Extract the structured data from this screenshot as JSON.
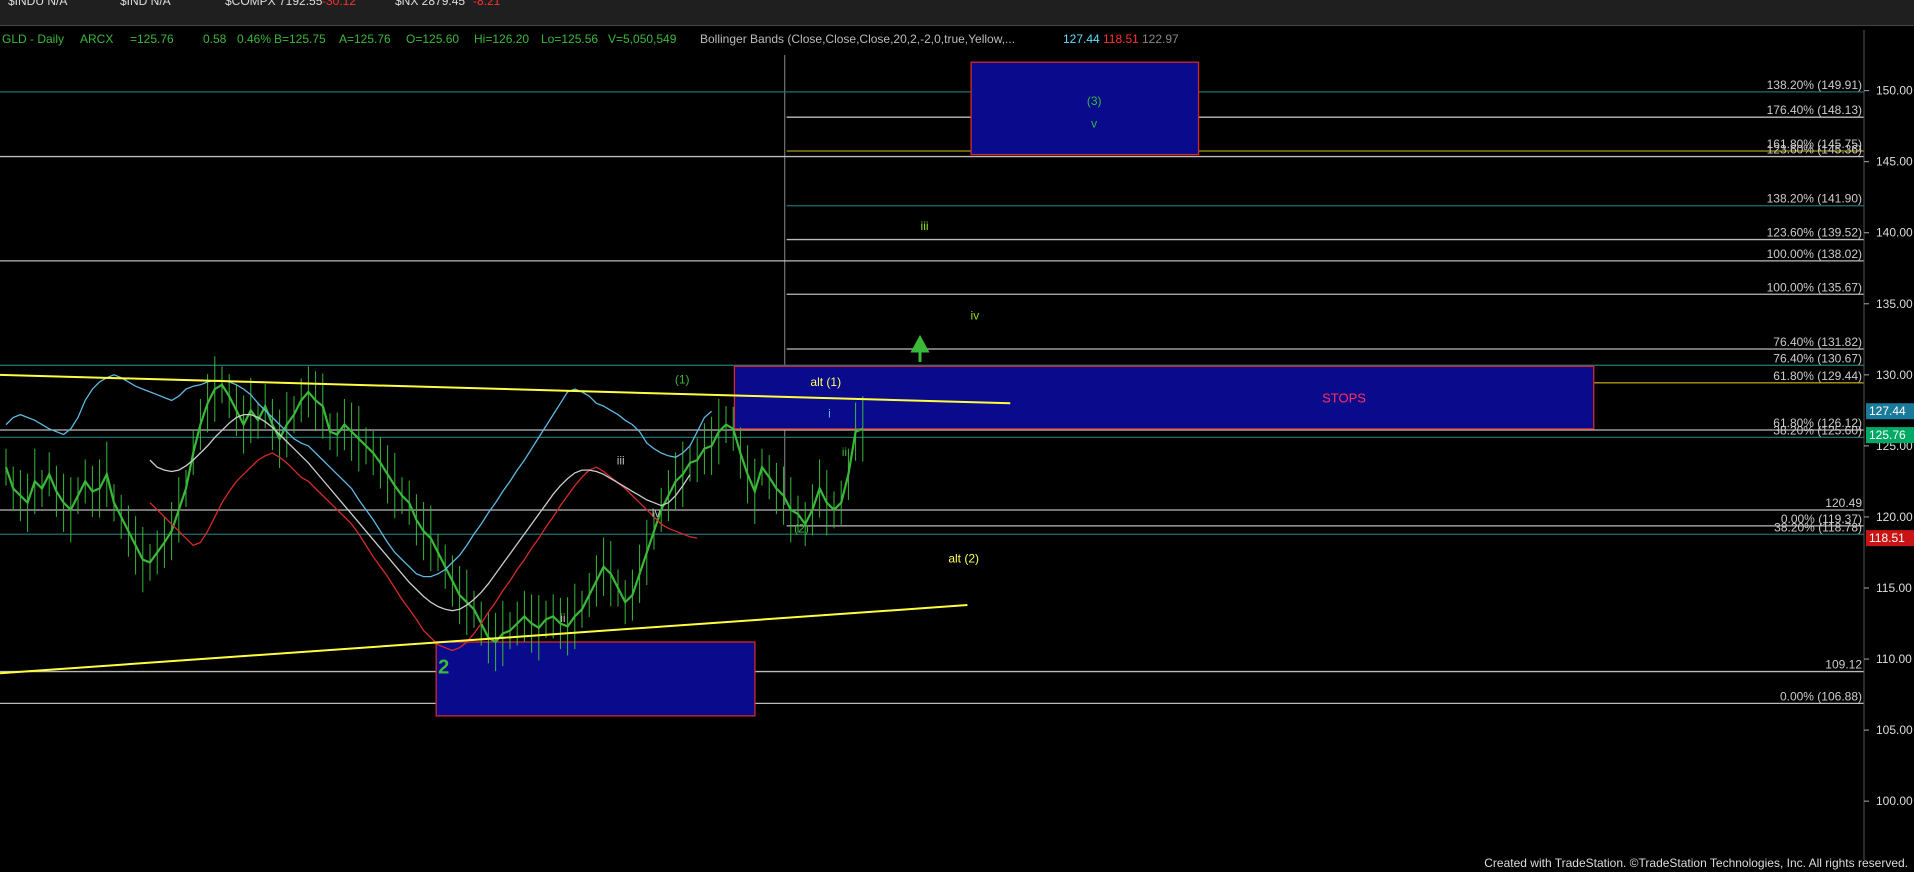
{
  "window": {
    "tickers": [
      {
        "symbol": "$INDU N/A",
        "change": ""
      },
      {
        "symbol": "$IND N/A",
        "change": ""
      },
      {
        "symbol": "$COMPX 7192.55",
        "change": "-30.12"
      },
      {
        "symbol": "$NX 2879.45",
        "change": "-8.21"
      }
    ]
  },
  "header": {
    "symbol": "GLD - Daily",
    "exchange": "ARCX",
    "last": "=125.76",
    "change": "0.58",
    "pct": "0.46%",
    "bid": "B=125.75",
    "ask": "A=125.76",
    "open": "O=125.60",
    "high": "Hi=126.20",
    "low": "Lo=125.56",
    "volume": "V=5,050,549",
    "study": "Bollinger Bands (Close,Close,Close,20,2,-2,0,true,Yellow,...",
    "bb_upper": "127.44",
    "bb_lower": "118.51",
    "bb_mid": "122.97"
  },
  "footer": "Created with TradeStation. ©TradeStation Technologies, Inc. All rights reserved.",
  "colors": {
    "price": "#3ab83a",
    "bb_upper": "#5fb8e0",
    "bb_lower": "#d42a2a",
    "bb_mid": "#cccccc",
    "trendline": "#ffff40",
    "box_fill": "#0a0a8c",
    "box_border": "#d42a2a",
    "level_label": "#cccccc",
    "last_price_tag": "#00aa66",
    "bb_upper_tag": "#1a7a9a",
    "bb_lower_tag": "#c81414"
  },
  "chart_data": {
    "type": "line",
    "title": "GLD - Daily",
    "ylim": [
      96,
      153
    ],
    "y_ticks": [
      100,
      105,
      110,
      115,
      120,
      125,
      130,
      135,
      140,
      145,
      150
    ],
    "bars": 120,
    "series": [
      {
        "name": "GLD",
        "values": [
          123.5,
          122,
          121.5,
          121,
          122.5,
          122,
          123,
          121.8,
          121,
          120.5,
          121.5,
          122.5,
          121.8,
          122,
          123,
          121,
          120,
          119,
          118,
          117,
          116.8,
          117.5,
          118.2,
          119,
          120.5,
          122,
          124.5,
          126.5,
          128,
          129,
          129.3,
          128.5,
          127.5,
          126.5,
          127.5,
          126.8,
          127.8,
          126.5,
          125.5,
          126.5,
          127.2,
          128.2,
          128.8,
          128.2,
          127.8,
          126,
          125.8,
          126.5,
          126,
          125.5,
          125,
          124.5,
          123.8,
          123,
          122.2,
          121.5,
          121,
          119.8,
          119,
          118.5,
          117.5,
          116.5,
          115.5,
          114.5,
          114,
          113.5,
          112.5,
          111.5,
          111.2,
          111.8,
          112,
          112.5,
          113,
          112.5,
          112.2,
          112.8,
          113,
          112.5,
          112.3,
          113,
          113.5,
          114.5,
          115.5,
          116.5,
          116,
          115,
          114,
          114.5,
          116,
          117.5,
          119,
          120.5,
          121.5,
          122.5,
          123,
          123.8,
          124,
          124.8,
          125,
          126,
          126.5,
          126.2,
          124.5,
          123,
          121.8,
          123.5,
          122.8,
          122,
          121.5,
          120.5,
          120.2,
          119.5,
          120.5,
          122,
          121,
          120.5,
          121,
          123,
          126,
          126.2
        ]
      },
      {
        "name": "BB Upper",
        "values": [
          126.5,
          127,
          127.2,
          127,
          126.8,
          126.5,
          126.2,
          126,
          125.8,
          126.2,
          127,
          128.2,
          129,
          129.5,
          129.8,
          130,
          129.8,
          129.5,
          129.2,
          129,
          128.8,
          128.6,
          128.4,
          128.2,
          128.5,
          129,
          129.2,
          129.3,
          129.5,
          129.6,
          129.6,
          129.5,
          129.3,
          129,
          128.6,
          128,
          127.5,
          127,
          126.5,
          126,
          125.5,
          125.2,
          125,
          124.5,
          124,
          123.5,
          123,
          122.5,
          122,
          121.2,
          120.5,
          119.8,
          119,
          118.2,
          117.5,
          117,
          116.5,
          116,
          115.8,
          115.8,
          116,
          116.3,
          116.8,
          117.3,
          118,
          118.8,
          119.5,
          120.3,
          121,
          121.8,
          122.5,
          123.3,
          124,
          124.8,
          125.6,
          126.4,
          127.2,
          128,
          128.8,
          129,
          128.8,
          128.5,
          128,
          127.8,
          127.5,
          127.2,
          126.8,
          126.5,
          126,
          125.2,
          124.8,
          124.5,
          124.3,
          124.2,
          124.5,
          125,
          126,
          127,
          127.44
        ]
      },
      {
        "name": "BB Lower",
        "values": [
          121,
          120.5,
          120,
          119.5,
          119,
          118.5,
          118,
          118.2,
          119,
          120,
          121,
          121.8,
          122.5,
          123,
          123.5,
          124,
          124.3,
          124.5,
          124.2,
          123.8,
          123.3,
          122.8,
          122.5,
          122,
          121.5,
          121,
          120.5,
          120,
          119.5,
          118.8,
          118,
          117.2,
          116.5,
          115.8,
          115,
          114.2,
          113.5,
          112.8,
          112,
          111.5,
          111,
          110.8,
          110.6,
          110.8,
          111.2,
          111.8,
          112.5,
          113.3,
          114,
          114.8,
          115.5,
          116.3,
          117,
          117.8,
          118.5,
          119.3,
          120,
          120.8,
          121.5,
          122.2,
          122.8,
          123.3,
          123.5,
          123.2,
          122.8,
          122.4,
          122,
          121.5,
          121,
          120.5,
          120,
          119.5,
          119.2,
          119,
          118.8,
          118.6,
          118.51
        ]
      },
      {
        "name": "BB Mid",
        "values": [
          124,
          123.5,
          123.3,
          123.2,
          123.3,
          123.6,
          124,
          124.5,
          125,
          125.6,
          126.1,
          126.6,
          127,
          127.2,
          127.2,
          127,
          126.7,
          126.3,
          125.8,
          125.3,
          124.8,
          124.3,
          123.8,
          123.2,
          122.6,
          122,
          121.4,
          120.8,
          120.2,
          119.6,
          119,
          118.4,
          117.8,
          117.2,
          116.6,
          116,
          115.4,
          114.9,
          114.4,
          114,
          113.7,
          113.5,
          113.4,
          113.5,
          113.8,
          114.2,
          114.7,
          115.3,
          116,
          116.7,
          117.4,
          118.1,
          118.8,
          119.5,
          120.2,
          120.9,
          121.6,
          122.2,
          122.7,
          123.1,
          123.3,
          123.3,
          123.2,
          123,
          122.7,
          122.4,
          122.1,
          121.8,
          121.5,
          121.2,
          121,
          120.8,
          121,
          121.5,
          122.2,
          122.97
        ]
      }
    ],
    "horizontal_levels": [
      {
        "label": "138.20% (149.91)",
        "y": 149.91,
        "color": "#1f6f6f",
        "x_from": 0
      },
      {
        "label": "176.40% (148.13)",
        "y": 148.13,
        "color": "#bbbbbb",
        "x_from": 0.422
      },
      {
        "label": "161.80% (145.75)",
        "y": 145.75,
        "color": "#b09a10",
        "x_from": 0.422
      },
      {
        "label": "123.60% (145.36)",
        "y": 145.36,
        "color": "#bbbbbb",
        "x_from": 0
      },
      {
        "label": "138.20% (141.90)",
        "y": 141.9,
        "color": "#1f6f6f",
        "x_from": 0.422
      },
      {
        "label": "123.60% (139.52)",
        "y": 139.52,
        "color": "#bbbbbb",
        "x_from": 0.422
      },
      {
        "label": "100.00% (138.02)",
        "y": 138.02,
        "color": "#bbbbbb",
        "x_from": 0
      },
      {
        "label": "100.00% (135.67)",
        "y": 135.67,
        "color": "#bbbbbb",
        "x_from": 0.422
      },
      {
        "label": "76.40% (131.82)",
        "y": 131.82,
        "color": "#bbbbbb",
        "x_from": 0.422
      },
      {
        "label": "76.40% (130.67)",
        "y": 130.67,
        "color": "#1f6f6f",
        "x_from": 0
      },
      {
        "label": "61.80% (129.44)",
        "y": 129.44,
        "color": "#b09a10",
        "x_from": 0.395
      },
      {
        "label": "61.80% (126.12)",
        "y": 126.12,
        "color": "#bbbbbb",
        "x_from": 0
      },
      {
        "label": "38.20% (125.60)",
        "y": 125.6,
        "color": "#1f6f6f",
        "x_from": 0
      },
      {
        "label": "120.49",
        "y": 120.49,
        "color": "#bbbbbb",
        "x_from": 0
      },
      {
        "label": "0.00% (119.37)",
        "y": 119.37,
        "color": "#bbbbbb",
        "x_from": 0.422
      },
      {
        "label": "38.20% (118.78)",
        "y": 118.78,
        "color": "#1f6f6f",
        "x_from": 0
      },
      {
        "label": "109.12",
        "y": 109.12,
        "color": "#bbbbbb",
        "x_from": 0
      },
      {
        "label": "0.00% (106.88)",
        "y": 106.88,
        "color": "#bbbbbb",
        "x_from": 0
      }
    ],
    "boxes": [
      {
        "name": "target-box-3",
        "x0": 0.521,
        "x1": 0.643,
        "y0": 145.5,
        "y1": 152,
        "label": ""
      },
      {
        "name": "stops-box",
        "x0": 0.394,
        "x1": 0.855,
        "y0": 126.2,
        "y1": 130.6,
        "label": "STOPS"
      },
      {
        "name": "wave-2-box",
        "x0": 0.234,
        "x1": 0.405,
        "y0": 106,
        "y1": 111.2,
        "label": ""
      }
    ],
    "trendlines": [
      {
        "x0": 0.0,
        "y0": 130.0,
        "x1": 0.542,
        "y1": 128.0
      },
      {
        "x0": 0.0,
        "y0": 109.0,
        "x1": 0.519,
        "y1": 113.8
      }
    ],
    "annotations": [
      {
        "text": "(3)",
        "x": 0.587,
        "y": 149.0,
        "color": "#3ab83a"
      },
      {
        "text": "v",
        "x": 0.587,
        "y": 147.4,
        "color": "#3ab83a"
      },
      {
        "text": "iii",
        "x": 0.496,
        "y": 140.2,
        "color": "#8fe020"
      },
      {
        "text": "iv",
        "x": 0.523,
        "y": 133.9,
        "color": "#8fe020"
      },
      {
        "text": "alt (1)",
        "x": 0.443,
        "y": 129.2,
        "color": "#ffff60"
      },
      {
        "text": "(1)",
        "x": 0.366,
        "y": 129.4,
        "color": "#3ab83a"
      },
      {
        "text": "i",
        "x": 0.445,
        "y": 127.0,
        "color": "#5fb8e0"
      },
      {
        "text": "ii",
        "x": 0.453,
        "y": 124.3,
        "color": "#3ab83a"
      },
      {
        "text": "iii",
        "x": 0.333,
        "y": 123.7,
        "color": "#bbbbbb"
      },
      {
        "text": "iv",
        "x": 0.352,
        "y": 120.0,
        "color": "#bbbbbb"
      },
      {
        "text": "(2)",
        "x": 0.43,
        "y": 118.9,
        "color": "#3ab83a"
      },
      {
        "text": "alt (2)",
        "x": 0.517,
        "y": 116.8,
        "color": "#ffff60"
      },
      {
        "text": "ii",
        "x": 0.302,
        "y": 112.6,
        "color": "#bbbbbb"
      },
      {
        "text": "2",
        "x": 0.238,
        "y": 109.0,
        "color": "#3ab83a"
      }
    ],
    "last_price": 125.76,
    "bb_upper_tag": 127.44,
    "bb_lower_tag": 118.51
  }
}
